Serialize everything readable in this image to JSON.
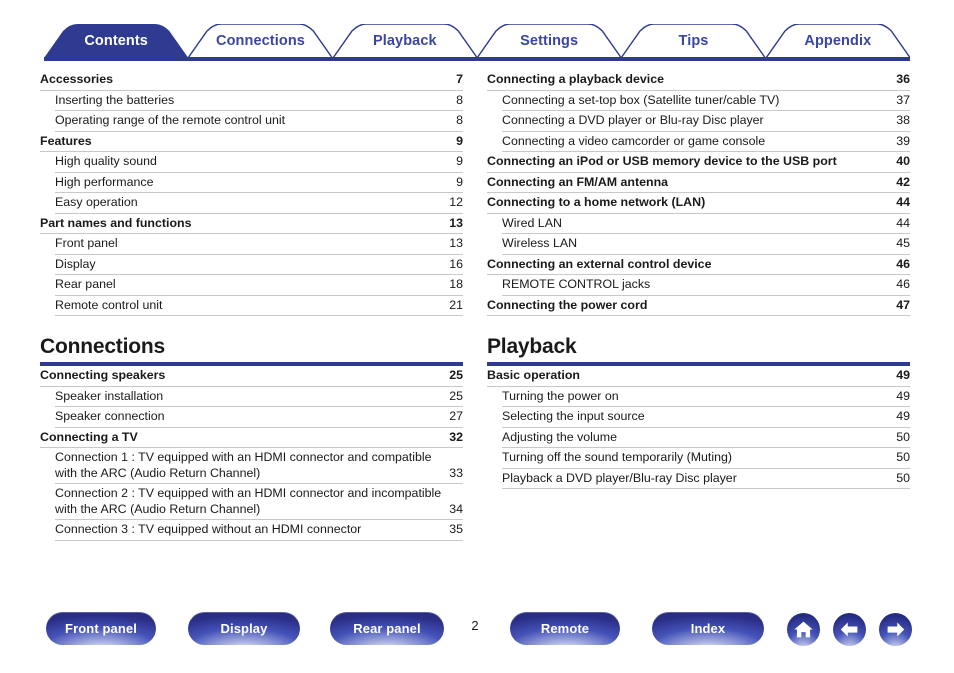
{
  "tabs": [
    {
      "label": "Contents",
      "active": true
    },
    {
      "label": "Connections",
      "active": false
    },
    {
      "label": "Playback",
      "active": false
    },
    {
      "label": "Settings",
      "active": false
    },
    {
      "label": "Tips",
      "active": false
    },
    {
      "label": "Appendix",
      "active": false
    }
  ],
  "colors": {
    "accent_blue": "#2e3b91",
    "tab_active_fill": "#2e3b91",
    "tab_inactive_text": "#3a46a0",
    "rule_gray": "#c8c8c8",
    "text": "#1a1a1a"
  },
  "left_column": [
    {
      "type": "toc",
      "entries": [
        {
          "level": 1,
          "text": "Accessories",
          "page": "7"
        },
        {
          "level": 2,
          "text": "Inserting the batteries",
          "page": "8"
        },
        {
          "level": 2,
          "text": "Operating range of the remote control unit",
          "page": "8"
        },
        {
          "level": 1,
          "text": "Features",
          "page": "9"
        },
        {
          "level": 2,
          "text": "High quality sound",
          "page": "9"
        },
        {
          "level": 2,
          "text": "High performance",
          "page": "9"
        },
        {
          "level": 2,
          "text": "Easy operation",
          "page": "12"
        },
        {
          "level": 1,
          "text": "Part names and functions",
          "page": "13"
        },
        {
          "level": 2,
          "text": "Front panel",
          "page": "13"
        },
        {
          "level": 2,
          "text": "Display",
          "page": "16"
        },
        {
          "level": 2,
          "text": "Rear panel",
          "page": "18"
        },
        {
          "level": 2,
          "text": "Remote control unit",
          "page": "21"
        }
      ]
    },
    {
      "type": "section",
      "title": "Connections",
      "entries": [
        {
          "level": 1,
          "text": "Connecting speakers",
          "page": "25"
        },
        {
          "level": 2,
          "text": "Speaker installation",
          "page": "25"
        },
        {
          "level": 2,
          "text": "Speaker connection",
          "page": "27"
        },
        {
          "level": 1,
          "text": "Connecting a TV",
          "page": "32"
        },
        {
          "level": 2,
          "text": "Connection 1 : TV equipped with an HDMI connector and compatible with the ARC (Audio Return Channel)",
          "page": "33"
        },
        {
          "level": 2,
          "text": "Connection 2 : TV equipped with an HDMI connector and incompatible with the ARC (Audio Return Channel)",
          "page": "34"
        },
        {
          "level": 2,
          "text": "Connection 3 : TV equipped without an HDMI connector",
          "page": "35"
        }
      ]
    }
  ],
  "right_column": [
    {
      "type": "toc",
      "entries": [
        {
          "level": 1,
          "text": "Connecting a playback device",
          "page": "36"
        },
        {
          "level": 2,
          "text": "Connecting a set-top box (Satellite tuner/cable TV)",
          "page": "37"
        },
        {
          "level": 2,
          "text": "Connecting a DVD player or Blu-ray Disc player",
          "page": "38"
        },
        {
          "level": 2,
          "text": "Connecting a video camcorder or game console",
          "page": "39"
        },
        {
          "level": 1,
          "text": "Connecting an iPod or USB memory device to the USB port",
          "page": "40"
        },
        {
          "level": 1,
          "text": "Connecting an FM/AM antenna",
          "page": "42"
        },
        {
          "level": 1,
          "text": "Connecting to a home network (LAN)",
          "page": "44"
        },
        {
          "level": 2,
          "text": "Wired LAN",
          "page": "44"
        },
        {
          "level": 2,
          "text": "Wireless LAN",
          "page": "45"
        },
        {
          "level": 1,
          "text": "Connecting an external control device",
          "page": "46"
        },
        {
          "level": 2,
          "text": "REMOTE CONTROL jacks",
          "page": "46"
        },
        {
          "level": 1,
          "text": "Connecting the power cord",
          "page": "47"
        }
      ]
    },
    {
      "type": "section",
      "title": "Playback",
      "entries": [
        {
          "level": 1,
          "text": "Basic operation",
          "page": "49"
        },
        {
          "level": 2,
          "text": "Turning the power on",
          "page": "49"
        },
        {
          "level": 2,
          "text": "Selecting the input source",
          "page": "49"
        },
        {
          "level": 2,
          "text": "Adjusting the volume",
          "page": "50"
        },
        {
          "level": 2,
          "text": "Turning off the sound temporarily (Muting)",
          "page": "50"
        },
        {
          "level": 2,
          "text": "Playback a DVD player/Blu-ray Disc player",
          "page": "50"
        }
      ]
    }
  ],
  "footer": {
    "page_number": "2",
    "buttons": [
      {
        "label": "Front panel",
        "name": "front-panel"
      },
      {
        "label": "Display",
        "name": "display"
      },
      {
        "label": "Rear panel",
        "name": "rear-panel"
      },
      {
        "label": "Remote",
        "name": "remote"
      },
      {
        "label": "Index",
        "name": "index"
      }
    ],
    "icons": [
      {
        "name": "home-icon"
      },
      {
        "name": "arrow-left-icon"
      },
      {
        "name": "arrow-right-icon"
      }
    ]
  }
}
